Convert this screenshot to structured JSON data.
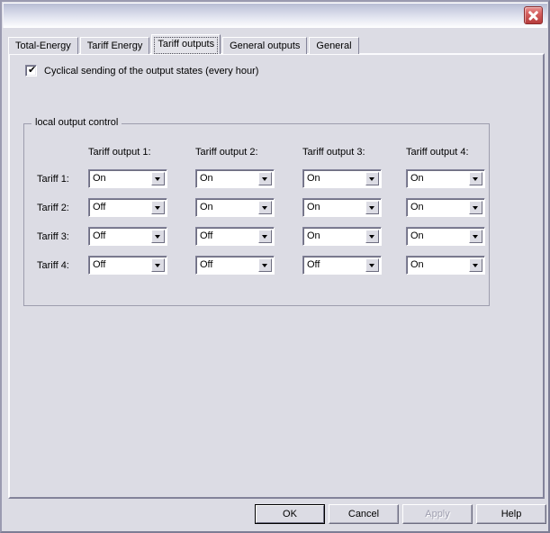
{
  "window": {
    "title": "",
    "close_icon": "close-icon"
  },
  "tabs": [
    {
      "label": "Total-Energy",
      "selected": false
    },
    {
      "label": "Tariff Energy",
      "selected": false
    },
    {
      "label": "Tariff outputs",
      "selected": true
    },
    {
      "label": "General outputs",
      "selected": false
    },
    {
      "label": "General",
      "selected": false
    }
  ],
  "cyclical": {
    "label": "Cyclical sending of the output states (every hour)",
    "checked": true,
    "check_glyph": "✔"
  },
  "group": {
    "legend": "local output control",
    "column_headers": [
      "Tariff output 1:",
      "Tariff output 2:",
      "Tariff output 3:",
      "Tariff output 4:"
    ],
    "row_labels": [
      "Tariff 1:",
      "Tariff 2:",
      "Tariff 3:",
      "Tariff 4:"
    ],
    "options": [
      "On",
      "Off"
    ],
    "values": [
      [
        "On",
        "On",
        "On",
        "On"
      ],
      [
        "Off",
        "On",
        "On",
        "On"
      ],
      [
        "Off",
        "Off",
        "On",
        "On"
      ],
      [
        "Off",
        "Off",
        "Off",
        "On"
      ]
    ]
  },
  "buttons": {
    "ok": "OK",
    "cancel": "Cancel",
    "apply": "Apply",
    "help": "Help"
  },
  "colors": {
    "dialog_face": "#dcdce4",
    "field_bg": "#ffffff",
    "close_red": "#b63c3c",
    "disabled_text": "#9d9dae"
  }
}
